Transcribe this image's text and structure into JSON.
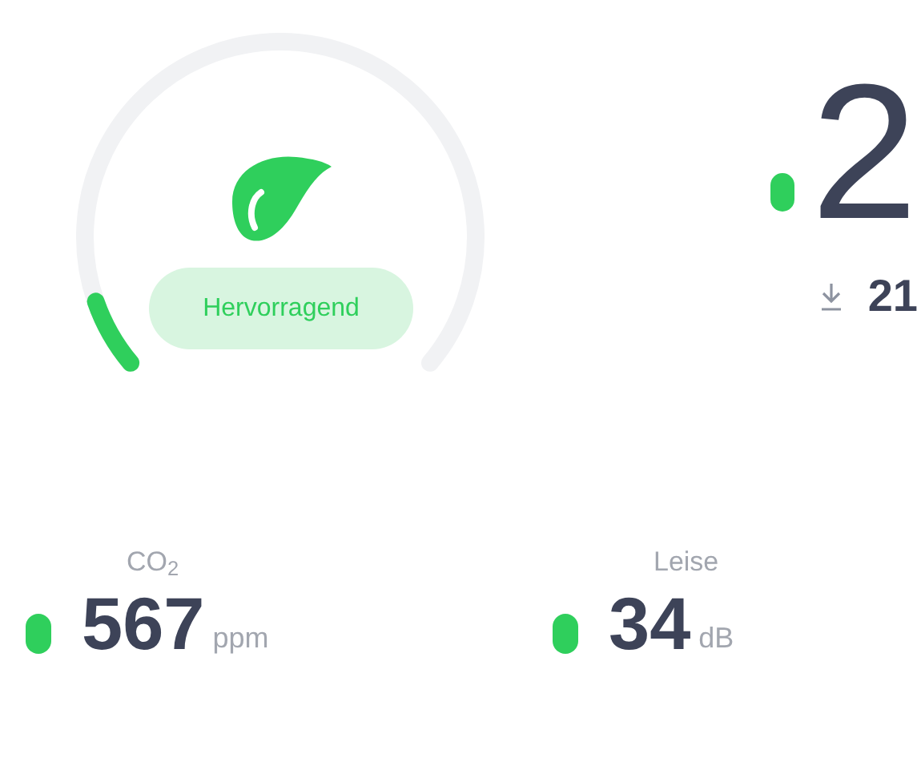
{
  "gauge": {
    "rating": "Hervorragend"
  },
  "headline": {
    "value": "2",
    "color": "#2fcf5c",
    "sub_value": "21"
  },
  "metrics": [
    {
      "label": "CO$_{2}$",
      "value": "567",
      "unit": "ppm",
      "color": "#2fcf5c"
    },
    {
      "label": "Leise",
      "value": "34",
      "unit": "dB",
      "color": "#2fcf5c"
    }
  ]
}
